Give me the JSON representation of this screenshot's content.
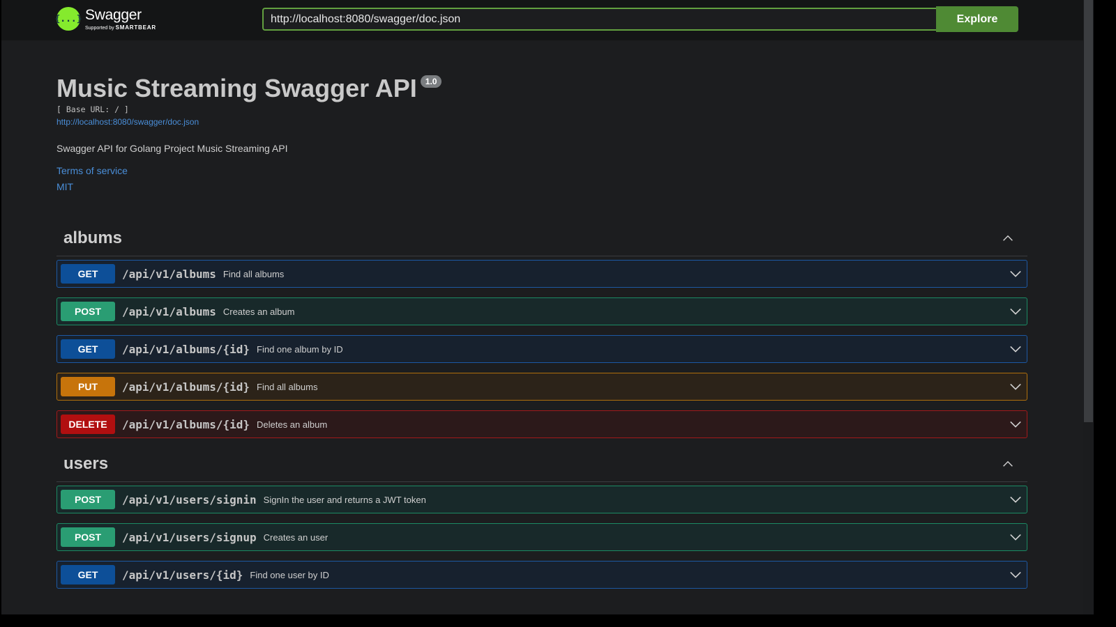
{
  "topbar": {
    "logo_title": "Swagger",
    "logo_sub_small": "Supported by",
    "logo_sub_brand": "SMARTBEAR",
    "url_value": "http://localhost:8080/swagger/doc.json",
    "explore_label": "Explore",
    "logo_icon": "{...}"
  },
  "info": {
    "title": "Music Streaming Swagger API",
    "version": "1.0",
    "base_url": "[ Base URL: / ]",
    "doc_link": "http://localhost:8080/swagger/doc.json",
    "description": "Swagger API for Golang Project Music Streaming API",
    "terms": "Terms of service",
    "license": "MIT"
  },
  "tags": [
    {
      "name": "albums",
      "operations": [
        {
          "method": "GET",
          "path": "/api/v1/albums",
          "summary": "Find all albums"
        },
        {
          "method": "POST",
          "path": "/api/v1/albums",
          "summary": "Creates an album"
        },
        {
          "method": "GET",
          "path": "/api/v1/albums/{id}",
          "summary": "Find one album by ID"
        },
        {
          "method": "PUT",
          "path": "/api/v1/albums/{id}",
          "summary": "Find all albums"
        },
        {
          "method": "DELETE",
          "path": "/api/v1/albums/{id}",
          "summary": "Deletes an album"
        }
      ]
    },
    {
      "name": "users",
      "operations": [
        {
          "method": "POST",
          "path": "/api/v1/users/signin",
          "summary": "SignIn the user and returns a JWT token"
        },
        {
          "method": "POST",
          "path": "/api/v1/users/signup",
          "summary": "Creates an user"
        },
        {
          "method": "GET",
          "path": "/api/v1/users/{id}",
          "summary": "Find one user by ID"
        }
      ]
    }
  ],
  "icons": {
    "tag_toggle": "chevron-up-icon",
    "op_toggle": "chevron-down-icon"
  },
  "colors": {
    "get": "#0d4f98",
    "post": "#2a9d73",
    "put": "#c7740b",
    "delete": "#b10f10",
    "explore": "#4f8a34",
    "logo": "#85ea2d"
  }
}
